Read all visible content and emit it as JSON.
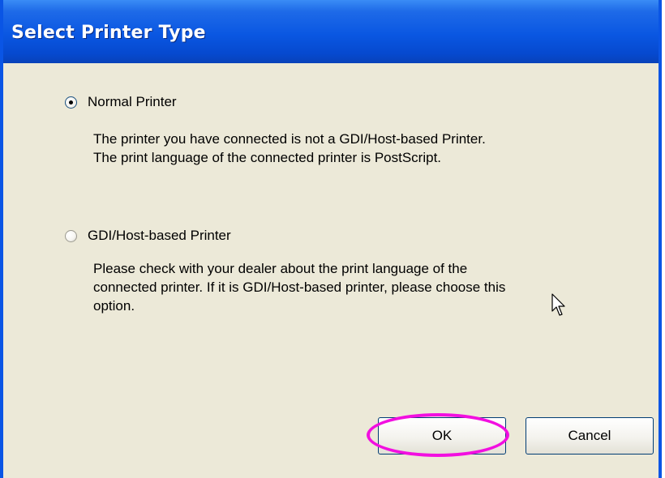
{
  "window": {
    "title": "Select Printer Type"
  },
  "options": [
    {
      "label": "Normal Printer",
      "selected": true,
      "description": "The printer you have connected is not a GDI/Host-based Printer.\nThe print language of the connected printer is PostScript."
    },
    {
      "label": "GDI/Host-based Printer",
      "selected": false,
      "description": "Please check with your dealer about the print language of the\nconnected printer. If it is GDI/Host-based printer, please choose this\noption."
    }
  ],
  "buttons": {
    "ok_label": "OK",
    "cancel_label": "Cancel"
  },
  "annotation": {
    "highlight_color": "#F20FE0",
    "highlighted_element": "ok-button"
  },
  "colors": {
    "titlebar": "#0A57E2",
    "window_border": "#0A55E5",
    "dialog_background": "#ECE9D8"
  }
}
